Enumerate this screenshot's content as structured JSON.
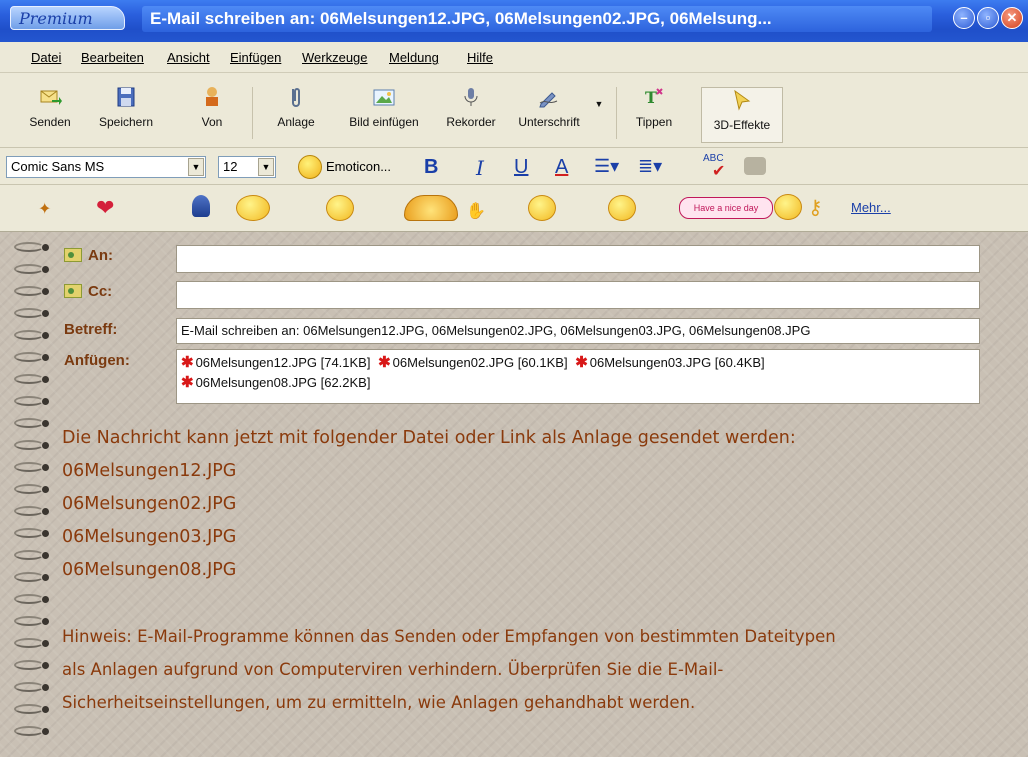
{
  "window": {
    "badge": "Premium",
    "title": "E-Mail schreiben an: 06Melsungen12.JPG, 06Melsungen02.JPG, 06Melsung..."
  },
  "menu": [
    "Datei",
    "Bearbeiten",
    "Ansicht",
    "Einfügen",
    "Werkzeuge",
    "Meldung",
    "Hilfe"
  ],
  "toolbar": {
    "send": "Senden",
    "save": "Speichern",
    "from": "Von",
    "attach": "Anlage",
    "insert_image": "Bild einfügen",
    "recorder": "Rekorder",
    "signature": "Unterschrift",
    "typing": "Tippen",
    "effects": "3D-Effekte"
  },
  "format": {
    "font": "Comic Sans MS",
    "size": "12",
    "emoticon": "Emoticon...",
    "bold": "B",
    "italic": "I",
    "underline": "U",
    "color": "A",
    "spell": "ABC"
  },
  "smileys": {
    "sticker_text": "Have a nice day",
    "more": "Mehr..."
  },
  "fields": {
    "to_label": "An:",
    "to_value": "",
    "cc_label": "Cc:",
    "cc_value": "",
    "subject_label": "Betreff:",
    "subject_value": "E-Mail schreiben an: 06Melsungen12.JPG, 06Melsungen02.JPG, 06Melsungen03.JPG, 06Melsungen08.JPG",
    "attach_label": "Anfügen:",
    "attachments": [
      "06Melsungen12.JPG [74.1KB]",
      "06Melsungen02.JPG [60.1KB]",
      "06Melsungen03.JPG [60.4KB]",
      "06Melsungen08.JPG [62.2KB]"
    ]
  },
  "body": {
    "intro": "Die Nachricht kann jetzt mit folgender Datei oder Link als Anlage gesendet werden:",
    "files": [
      "06Melsungen12.JPG",
      "06Melsungen02.JPG",
      "06Melsungen03.JPG",
      "06Melsungen08.JPG"
    ],
    "note_line1": "Hinweis: E-Mail-Programme können das Senden oder Empfangen von bestimmten Dateitypen",
    "note_line2": "als Anlagen aufgrund von Computerviren verhindern. Überprüfen Sie die E-Mail-",
    "note_line3": "Sicherheitseinstellungen, um zu ermitteln, wie Anlagen gehandhabt werden."
  }
}
